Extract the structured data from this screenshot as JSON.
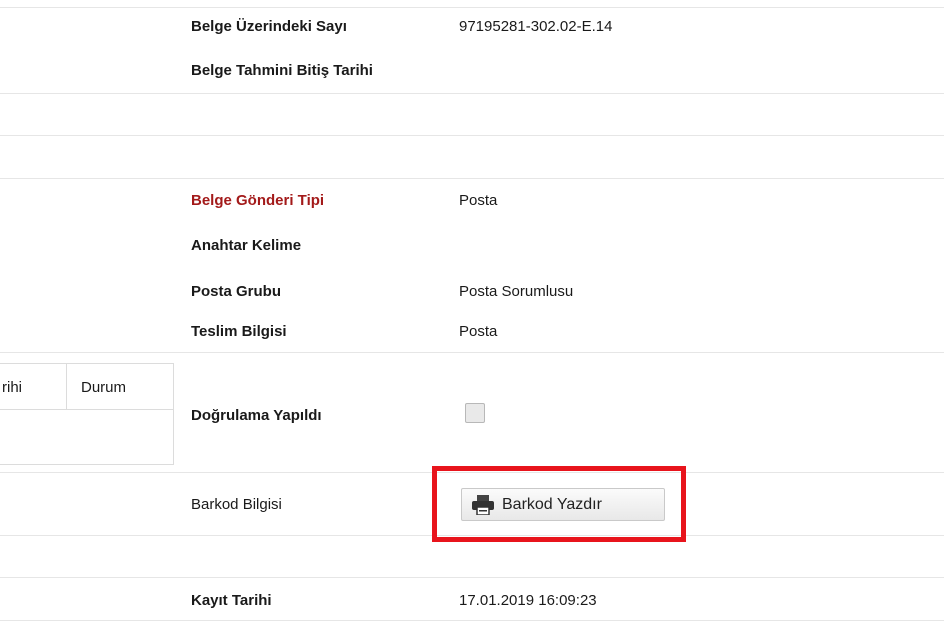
{
  "rows": {
    "sayi": {
      "label": "Belge Üzerindeki Sayı",
      "value": "97195281-302.02-E.14"
    },
    "bitis": {
      "label": "Belge Tahmini Bitiş Tarihi",
      "value": ""
    },
    "gonderi": {
      "label": "Belge Gönderi Tipi",
      "value": "Posta"
    },
    "anahtar": {
      "label": "Anahtar Kelime",
      "value": ""
    },
    "posta_grubu": {
      "label": "Posta Grubu",
      "value": "Posta Sorumlusu"
    },
    "teslim": {
      "label": "Teslim Bilgisi",
      "value": "Posta"
    },
    "dogrulama": {
      "label": "Doğrulama Yapıldı",
      "checked": false
    },
    "barkod": {
      "label": "Barkod Bilgisi",
      "button_label": "Barkod Yazdır",
      "icon": "printer-icon"
    },
    "kayit": {
      "label": "Kayıt Tarihi",
      "value": "17.01.2019 16:09:23"
    }
  },
  "mini_table": {
    "columns": [
      "rihi",
      "Durum"
    ]
  },
  "colors": {
    "required_label": "#a31a1a",
    "highlight": "#e8141c"
  }
}
